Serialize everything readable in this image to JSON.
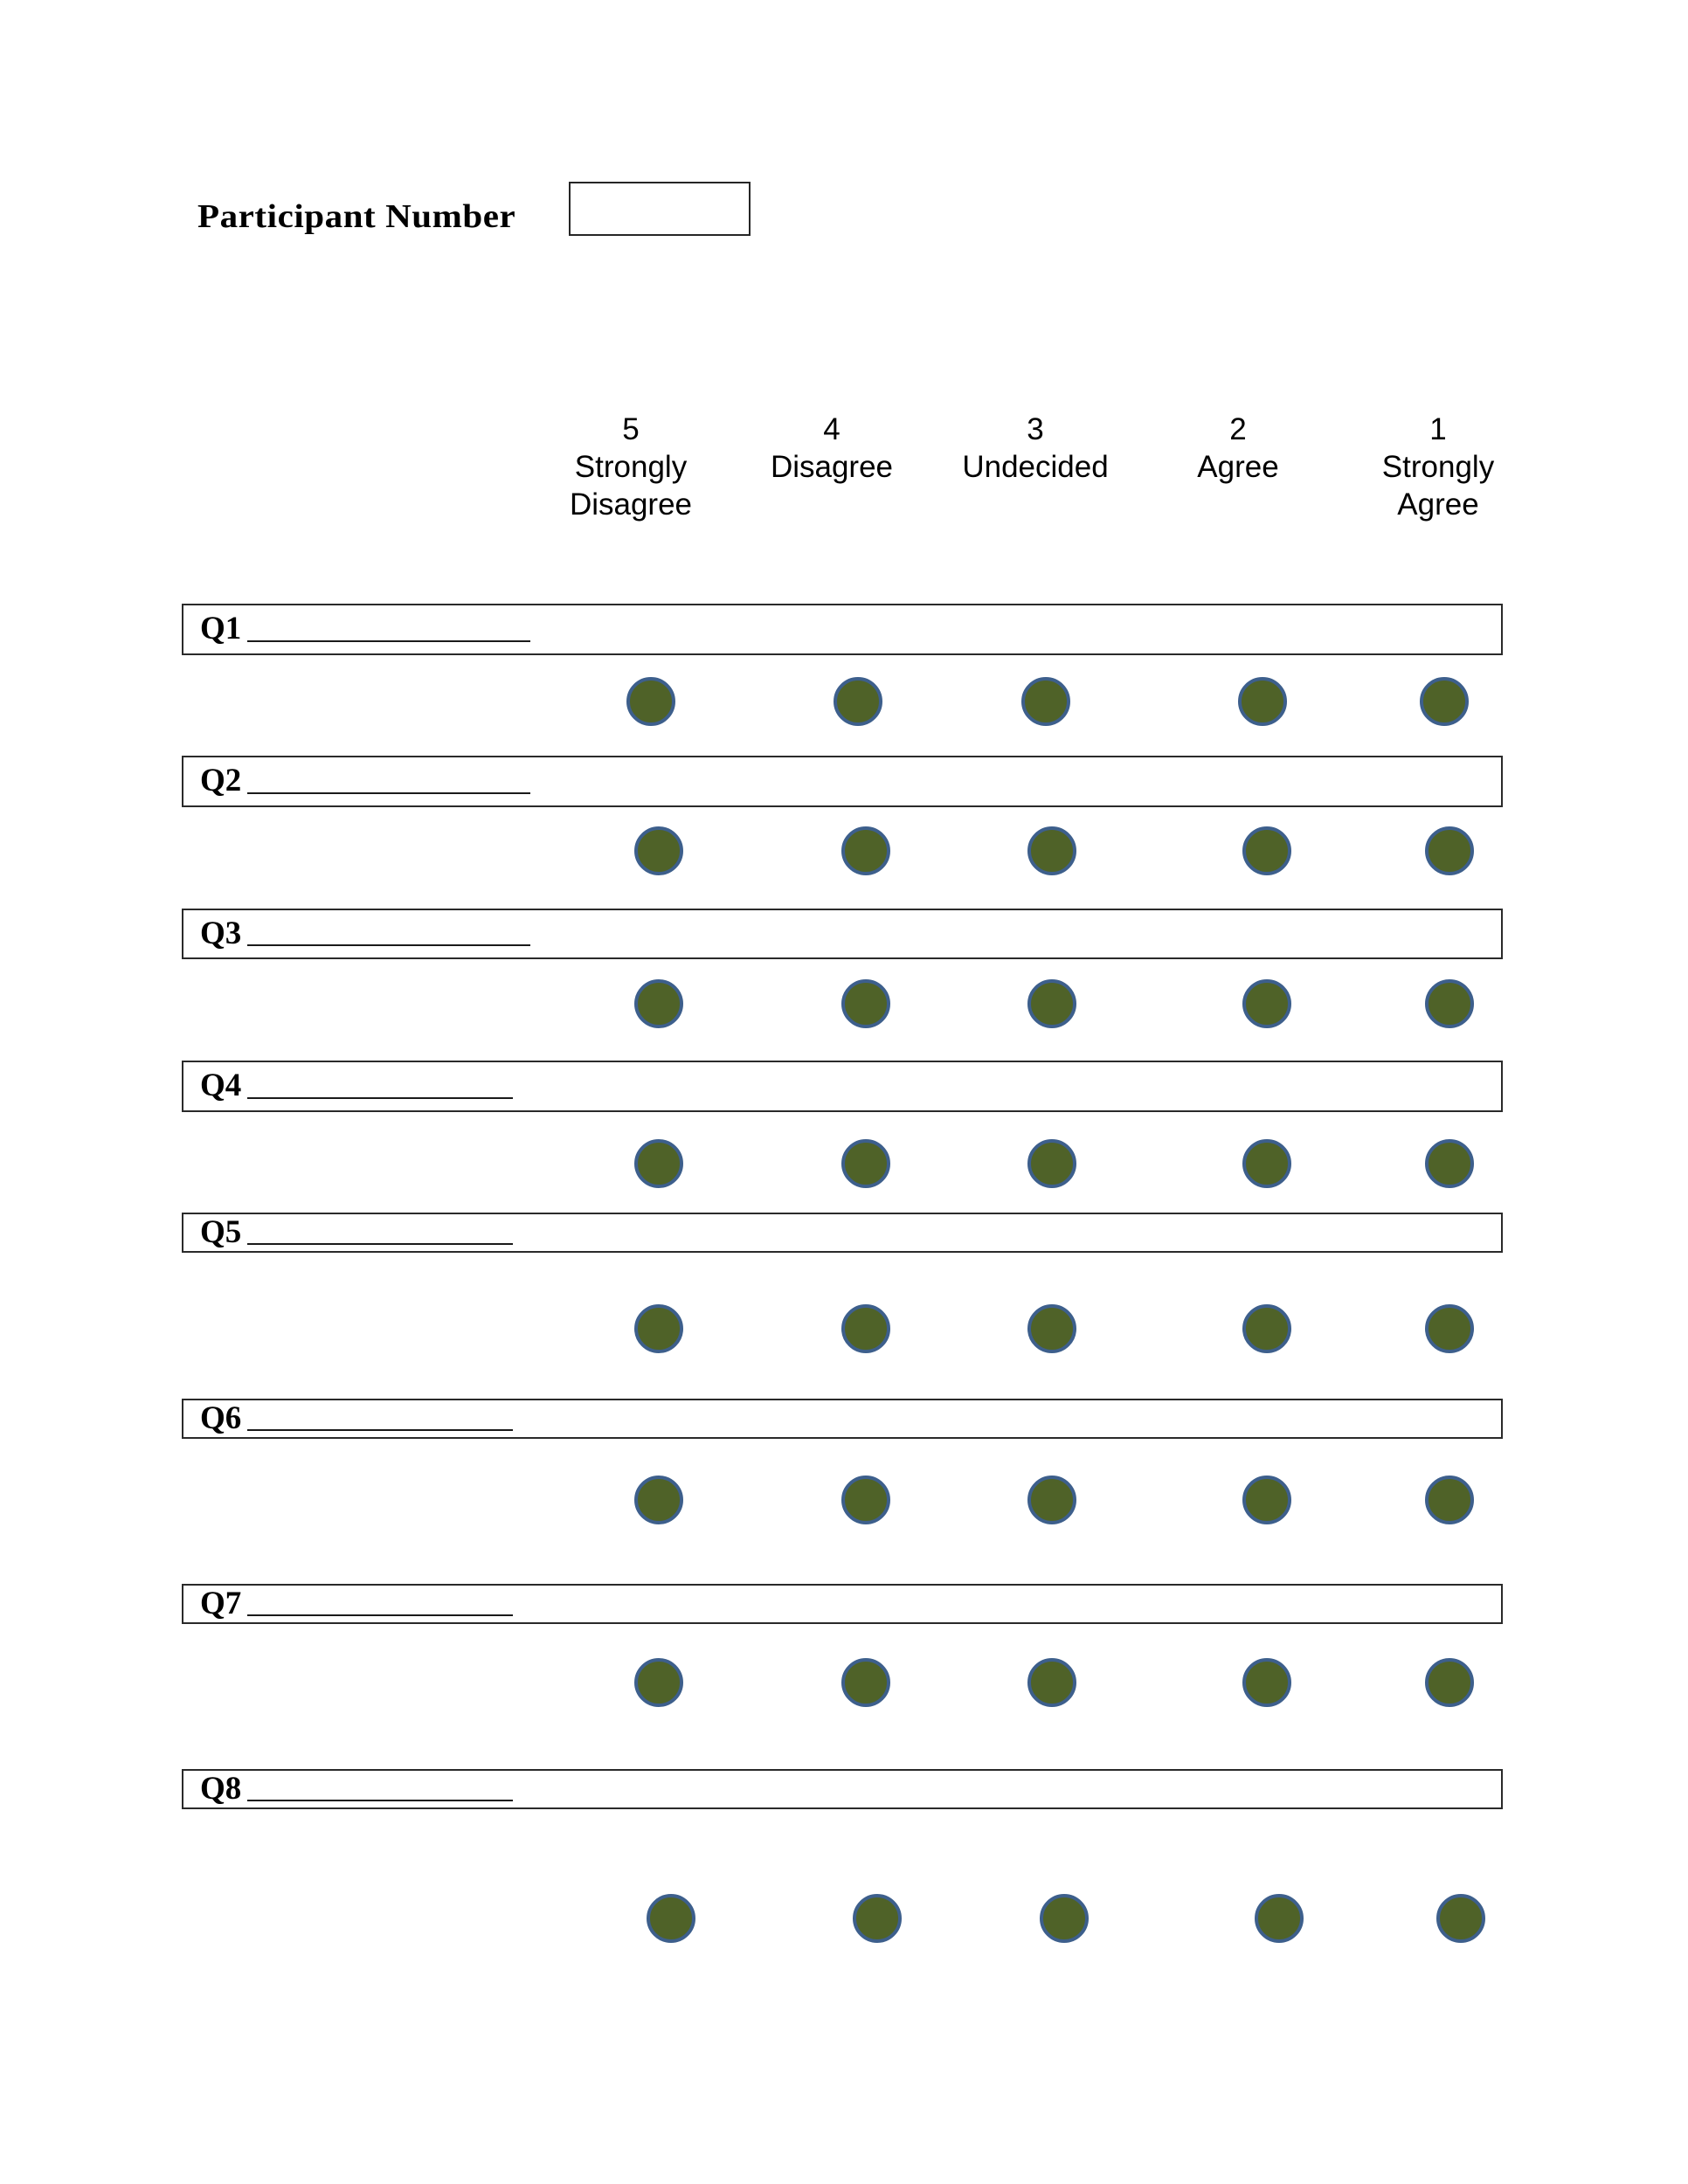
{
  "header": {
    "participant_label": "Participant Number",
    "participant_value": ""
  },
  "scale": [
    {
      "value": "5",
      "label_lines": [
        "Strongly",
        "Disagree"
      ]
    },
    {
      "value": "4",
      "label_lines": [
        "Disagree"
      ]
    },
    {
      "value": "3",
      "label_lines": [
        "Undecided"
      ]
    },
    {
      "value": "2",
      "label_lines": [
        "Agree"
      ]
    },
    {
      "value": "1",
      "label_lines": [
        "Strongly",
        "Agree"
      ]
    }
  ],
  "questions": [
    {
      "label": "Q1",
      "text": "",
      "selected": null
    },
    {
      "label": "Q2",
      "text": "",
      "selected": null
    },
    {
      "label": "Q3",
      "text": "",
      "selected": null
    },
    {
      "label": "Q4",
      "text": "",
      "selected": null
    },
    {
      "label": "Q5",
      "text": "",
      "selected": null
    },
    {
      "label": "Q6",
      "text": "",
      "selected": null
    },
    {
      "label": "Q7",
      "text": "",
      "selected": null
    },
    {
      "label": "Q8",
      "text": "",
      "selected": null
    }
  ],
  "colors": {
    "circle_fill": "#4f6228",
    "circle_border": "#3d5f8c",
    "box_border": "#2a2a2a"
  }
}
